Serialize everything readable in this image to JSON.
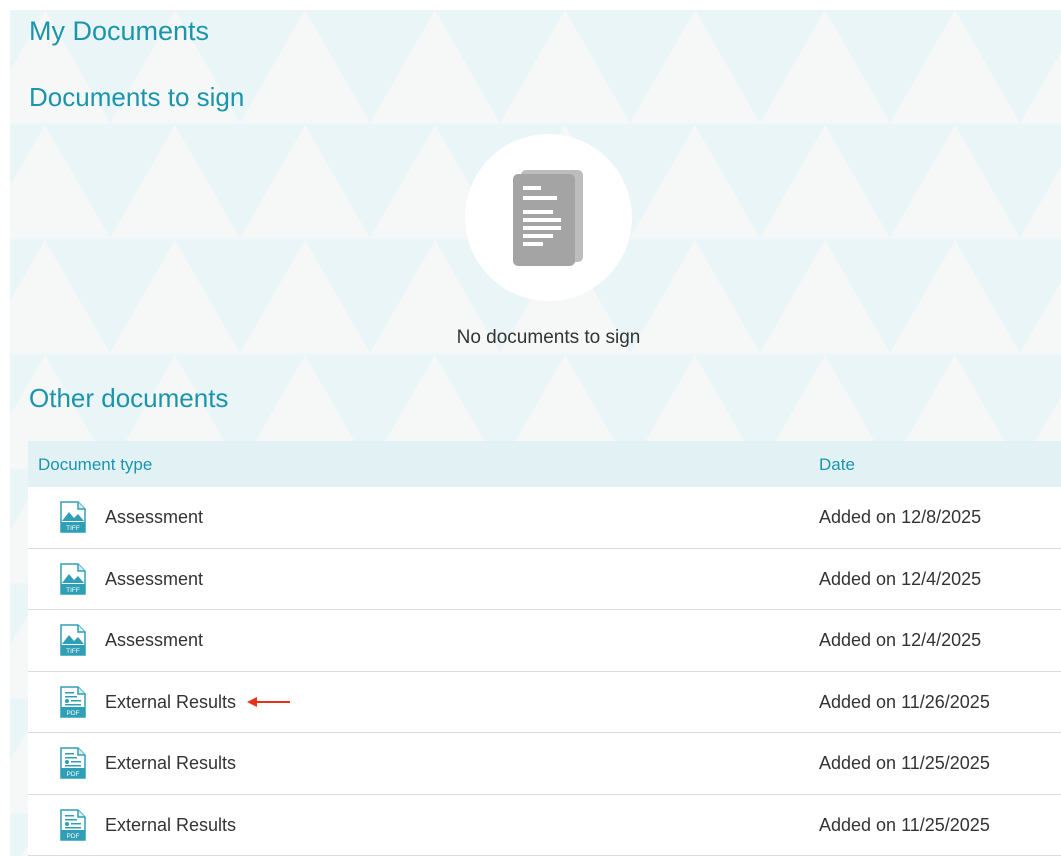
{
  "page": {
    "title": "My Documents"
  },
  "sign_section": {
    "title": "Documents to sign",
    "empty_icon": "document-stack-icon",
    "empty_text": "No documents to sign"
  },
  "other_section": {
    "title": "Other documents",
    "columns": {
      "type": "Document type",
      "date": "Date"
    },
    "rows": [
      {
        "type": "Assessment",
        "date": "Added on 12/8/2025",
        "file_icon": "tiff-file-icon",
        "icon_label": "TIFF"
      },
      {
        "type": "Assessment",
        "date": "Added on 12/4/2025",
        "file_icon": "tiff-file-icon",
        "icon_label": "TIFF"
      },
      {
        "type": "Assessment",
        "date": "Added on 12/4/2025",
        "file_icon": "tiff-file-icon",
        "icon_label": "TIFF"
      },
      {
        "type": "External Results",
        "date": "Added on 11/26/2025",
        "file_icon": "pdf-file-icon",
        "icon_label": "PDF",
        "annotated": true
      },
      {
        "type": "External Results",
        "date": "Added on 11/25/2025",
        "file_icon": "pdf-file-icon",
        "icon_label": "PDF"
      },
      {
        "type": "External Results",
        "date": "Added on 11/25/2025",
        "file_icon": "pdf-file-icon",
        "icon_label": "PDF"
      }
    ]
  },
  "colors": {
    "accent": "#1a95ad",
    "background": "#edf6f8",
    "header_row": "#e2f1f4",
    "annotation_arrow": "#e8311a",
    "empty_icon": "#a0a0a0"
  }
}
